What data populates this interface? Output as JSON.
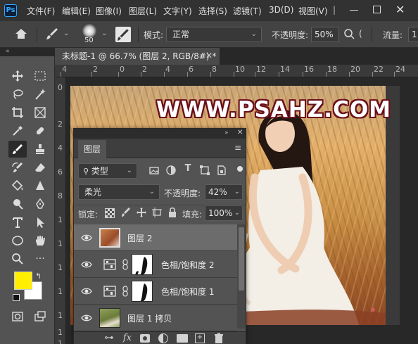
{
  "app": {
    "logo_text": "Ps",
    "menus": [
      "文件(F)",
      "编辑(E)",
      "图像(I)",
      "图层(L)",
      "文字(Y)",
      "选择(S)",
      "滤镜(T)",
      "3D(D)",
      "视图(V)"
    ],
    "menu_overflow": "|"
  },
  "options": {
    "brush_size": "50",
    "mode_label": "模式:",
    "mode_value": "正常",
    "opacity_label": "不透明度:",
    "opacity_value": "50%",
    "flow_label": "流量:",
    "flow_value": "1"
  },
  "document": {
    "tab_title": "未标题-1 @ 66.7% (图层 2, RGB/8#) *",
    "ruler_ticks": [
      "4",
      "2",
      "0",
      "2",
      "4",
      "6",
      "8",
      "10",
      "12",
      "14",
      "16",
      "18",
      "20",
      "22",
      "24"
    ],
    "ruler_left_ticks": [
      "0",
      "2",
      "4",
      "6",
      "8",
      "1",
      "1",
      "1",
      "1",
      "1",
      "1",
      "1"
    ],
    "watermark": "WWW.PSAHZ.COM"
  },
  "colors": {
    "foreground": "#ffee00",
    "background": "#ffffff",
    "accent": "#31a8ff"
  },
  "layers_panel": {
    "tab_label": "图层",
    "filter_label": "类型",
    "blend_mode": "柔光",
    "opacity_label": "不透明度:",
    "opacity_value": "42%",
    "lock_label": "锁定:",
    "fill_label": "填充:",
    "fill_value": "100%",
    "layers": [
      {
        "name": "图层 2",
        "type": "pixel",
        "selected": true,
        "visible": true
      },
      {
        "name": "色相/饱和度 2",
        "type": "adjustment",
        "selected": false,
        "visible": true
      },
      {
        "name": "色相/饱和度 1",
        "type": "adjustment",
        "selected": false,
        "visible": true
      },
      {
        "name": "图层 1 拷贝",
        "type": "pixel",
        "selected": false,
        "visible": true
      }
    ],
    "bottom_icons": [
      "link-icon",
      "fx-icon",
      "mask-icon",
      "adjustment-icon",
      "group-icon",
      "new-layer-icon",
      "trash-icon"
    ],
    "fx_label": "fx"
  }
}
